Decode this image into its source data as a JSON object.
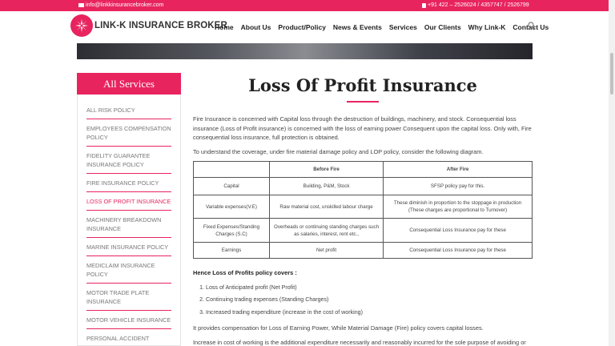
{
  "topbar": {
    "email": "info@linkkinsurancebroker.com",
    "phone": "+91 422 – 2526024 / 4357747 / 2526799"
  },
  "brand": {
    "name": "LINK-K INSURANCE BROKER"
  },
  "nav": [
    "Home",
    "About Us",
    "Product/Policy",
    "News & Events",
    "Services",
    "Our Clients",
    "Why Link-K",
    "Contact Us"
  ],
  "sidebar": {
    "heading": "All Services",
    "items": [
      "ALL RISK POLICY",
      "EMPLOYEES COMPENSATION POLICY",
      "FIDELITY GUARANTEE INSURANCE POLICY",
      "FIRE INSURANCE POLICY",
      "LOSS OF PROFIT INSURANCE",
      "MACHINERY BREAKDOWN INSURANCE",
      "MARINE INSURANCE POLICY",
      "MEDICLAIM INSURANCE POLICY",
      "MOTOR TRADE PLATE INSURANCE",
      "MOTOR VEHICLE INSURANCE",
      "PERSONAL ACCIDENT INSURANCE"
    ],
    "active_index": 4
  },
  "page": {
    "title": "Loss Of Profit Insurance",
    "intro": "Fire Insurance is concerned with Capital loss through the destruction of buildings, machinery, and stock. Consequential loss insurance (Loss of Profit insurance) is concerned with the loss of earning power Consequent upon the capital loss. Only with, Fire consequential loss insurance, full protection is obtained.",
    "diagram_intro": "To understand the coverage, under fire material damage policy and LOP policy, consider the following diagram.",
    "table": {
      "headers": [
        "",
        "Before Fire",
        "After Fire"
      ],
      "rows": [
        [
          "Capital",
          "Building, P&M, Stock",
          "SFSP policy pay for this."
        ],
        [
          "Variable expenses(V.E)",
          "Raw material cost, unskilled labour charge",
          "These diminish in proportion to the stoppage in production (These charges are proportional to Turnover)"
        ],
        [
          "Fixed Expenses/Standing Charges (S.C)",
          "Overheads or continuing standing charges such as salaries, interest, rent etc.,",
          "Consequential Loss Insurance pay for these"
        ],
        [
          "Earnings",
          "Net profit",
          "Consequential Loss Insurance pay for these"
        ]
      ]
    },
    "covers_heading": "Hence Loss of Profits policy covers :",
    "covers": [
      "Loss of Anticipated profit (Net Profit)",
      "Continuing trading expenses (Standing Charges)",
      "Increased trading expenditure (increase in the cost of working)"
    ],
    "compensation": "It provides compensation for Loss of Earning Power, While Material Damage (Fire) policy covers capital losses.",
    "increase_text": "Increase in cost of working is the additional expenditure necessarily and reasonably incurred for the sole purpose of avoiding or"
  },
  "colors": {
    "accent": "#e8245f"
  },
  "icons": {
    "email": "mail-icon",
    "phone": "phone-icon",
    "search": "search-icon",
    "logo": "logo-icon"
  }
}
